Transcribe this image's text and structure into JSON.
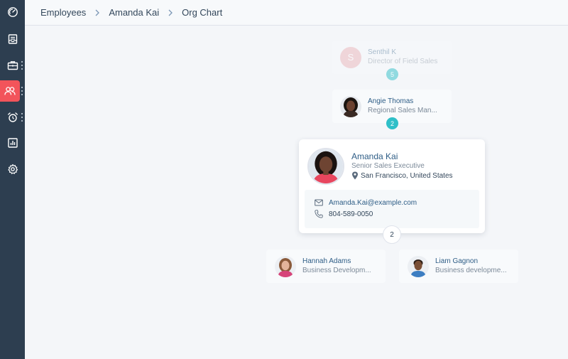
{
  "breadcrumb": {
    "items": [
      "Employees",
      "Amanda Kai"
    ],
    "current": "Org Chart"
  },
  "sidebar": {
    "items": [
      {
        "icon": "dashboard-icon"
      },
      {
        "icon": "inbox-icon"
      },
      {
        "icon": "briefcase-icon"
      },
      {
        "icon": "people-icon",
        "active": true
      },
      {
        "icon": "alarm-clock-icon"
      },
      {
        "icon": "bar-chart-icon"
      },
      {
        "icon": "gear-icon"
      }
    ]
  },
  "org": {
    "top": {
      "initial": "S",
      "name": "Senthil K",
      "title": "Director of Field Sales",
      "reports": "5"
    },
    "manager": {
      "name": "Angie Thomas",
      "title": "Regional Sales Man...",
      "reports": "2"
    },
    "focus": {
      "name": "Amanda Kai",
      "title": "Senior Sales Executive",
      "location": "San Francisco, United States",
      "email": "Amanda.Kai@example.com",
      "phone": "804-589-0050",
      "reports": "2"
    },
    "reports": [
      {
        "name": "Hannah Adams",
        "title": "Business Developm..."
      },
      {
        "name": "Liam Gagnon",
        "title": "Business developme..."
      }
    ]
  },
  "colors": {
    "sidebar": "#2d3e50",
    "accent": "#f2545b",
    "badge": "#2fbfc8",
    "link": "#2e5d86"
  }
}
